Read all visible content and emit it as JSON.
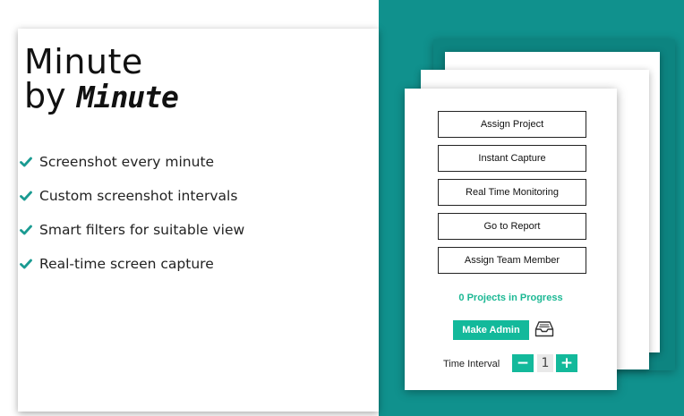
{
  "title": {
    "line1": "Minute",
    "line2a": "by ",
    "line2b": "Minute"
  },
  "features": [
    "Screenshot every minute",
    "Custom screenshot intervals",
    "Smart filters for suitable view",
    "Real-time screen capture"
  ],
  "card": {
    "actions": [
      "Assign Project",
      "Instant Capture",
      "Real Time Monitoring",
      "Go to Report",
      "Assign Team Member"
    ],
    "progress_text": "0 Projects in Progress",
    "make_admin_label": "Make Admin",
    "inbox_icon": "inbox-tray-icon",
    "interval_label": "Time Interval",
    "decrement_label": "−",
    "interval_value": "1",
    "increment_label": "+"
  },
  "colors": {
    "teal_background": "#10918d",
    "accent_green": "#13b99b",
    "check_teal": "#1a9b92"
  }
}
